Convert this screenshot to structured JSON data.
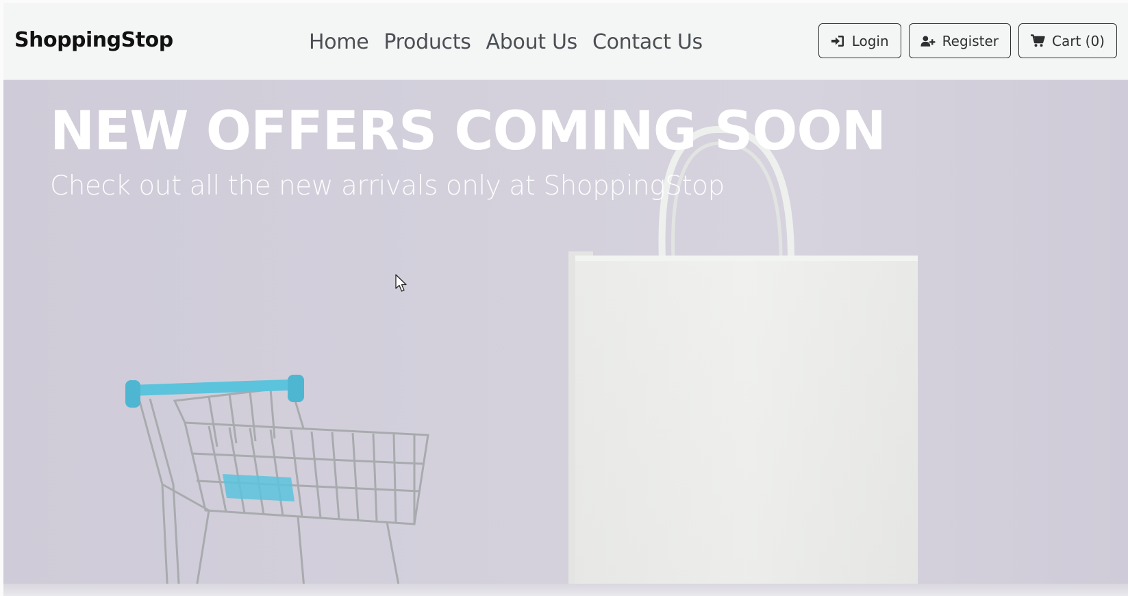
{
  "navbar": {
    "brand": "ShoppingStop",
    "links": [
      {
        "label": "Home",
        "name": "nav-link-home"
      },
      {
        "label": "Products",
        "name": "nav-link-products"
      },
      {
        "label": "About Us",
        "name": "nav-link-about-us"
      },
      {
        "label": "Contact Us",
        "name": "nav-link-contact-us"
      }
    ],
    "actions": {
      "login_label": "Login",
      "login_icon": "sign-in-icon",
      "register_label": "Register",
      "register_icon": "user-plus-icon",
      "cart_label": "Cart (0)",
      "cart_icon": "shopping-cart-icon"
    }
  },
  "hero": {
    "title": "NEW OFFERS COMING SOON",
    "subtitle": "Check out all the new arrivals only at ShoppingStop",
    "background_color": "#d3d0dc",
    "accent_color": "#5bc3dc"
  }
}
